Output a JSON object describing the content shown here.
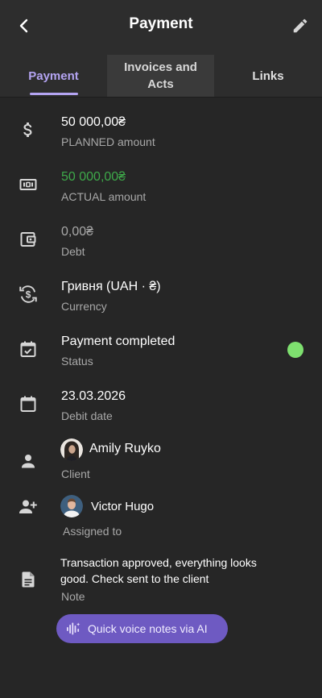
{
  "header": {
    "title": "Payment"
  },
  "tabs": [
    {
      "label": "Payment"
    },
    {
      "label": "Invoices and Acts"
    },
    {
      "label": "Links"
    }
  ],
  "details": {
    "planned": {
      "value": "50 000,00₴",
      "label": "PLANNED amount"
    },
    "actual": {
      "value": "50 000,00₴",
      "label": "ACTUAL amount"
    },
    "debt": {
      "value": "0,00₴",
      "label": "Debt"
    },
    "currency": {
      "value": "Гривня (UAH · ₴)",
      "label": "Currency"
    },
    "status": {
      "value": "Payment completed",
      "label": "Status"
    },
    "debit_date": {
      "value": "23.03.2026",
      "label": "Debit date"
    },
    "client": {
      "name": "Amily Ruyko",
      "label": "Client"
    },
    "assigned": {
      "name": "Victor Hugo",
      "label": "Assigned to"
    },
    "note": {
      "text": "Transaction approved, everything looks good. Check sent to the client",
      "label": "Note"
    }
  },
  "ai_button": {
    "label": "Quick voice notes via AI"
  },
  "colors": {
    "background": "#262626",
    "header": "#2d2d2d",
    "accent": "#b4a4f2",
    "actual_amount": "#3ea94a",
    "status_dot": "#7ee06f",
    "ai_button": "#6e5ac2"
  },
  "icons": {
    "back": "chevron-left-icon",
    "edit": "pencil-icon",
    "planned": "dollar-icon",
    "actual": "banknote-icon",
    "debt": "wallet-icon",
    "currency": "currency-exchange-icon",
    "status": "calendar-check-icon",
    "debit_date": "calendar-icon",
    "client": "person-icon",
    "assigned": "person-add-icon",
    "note": "document-icon",
    "ai": "voice-wave-icon"
  }
}
